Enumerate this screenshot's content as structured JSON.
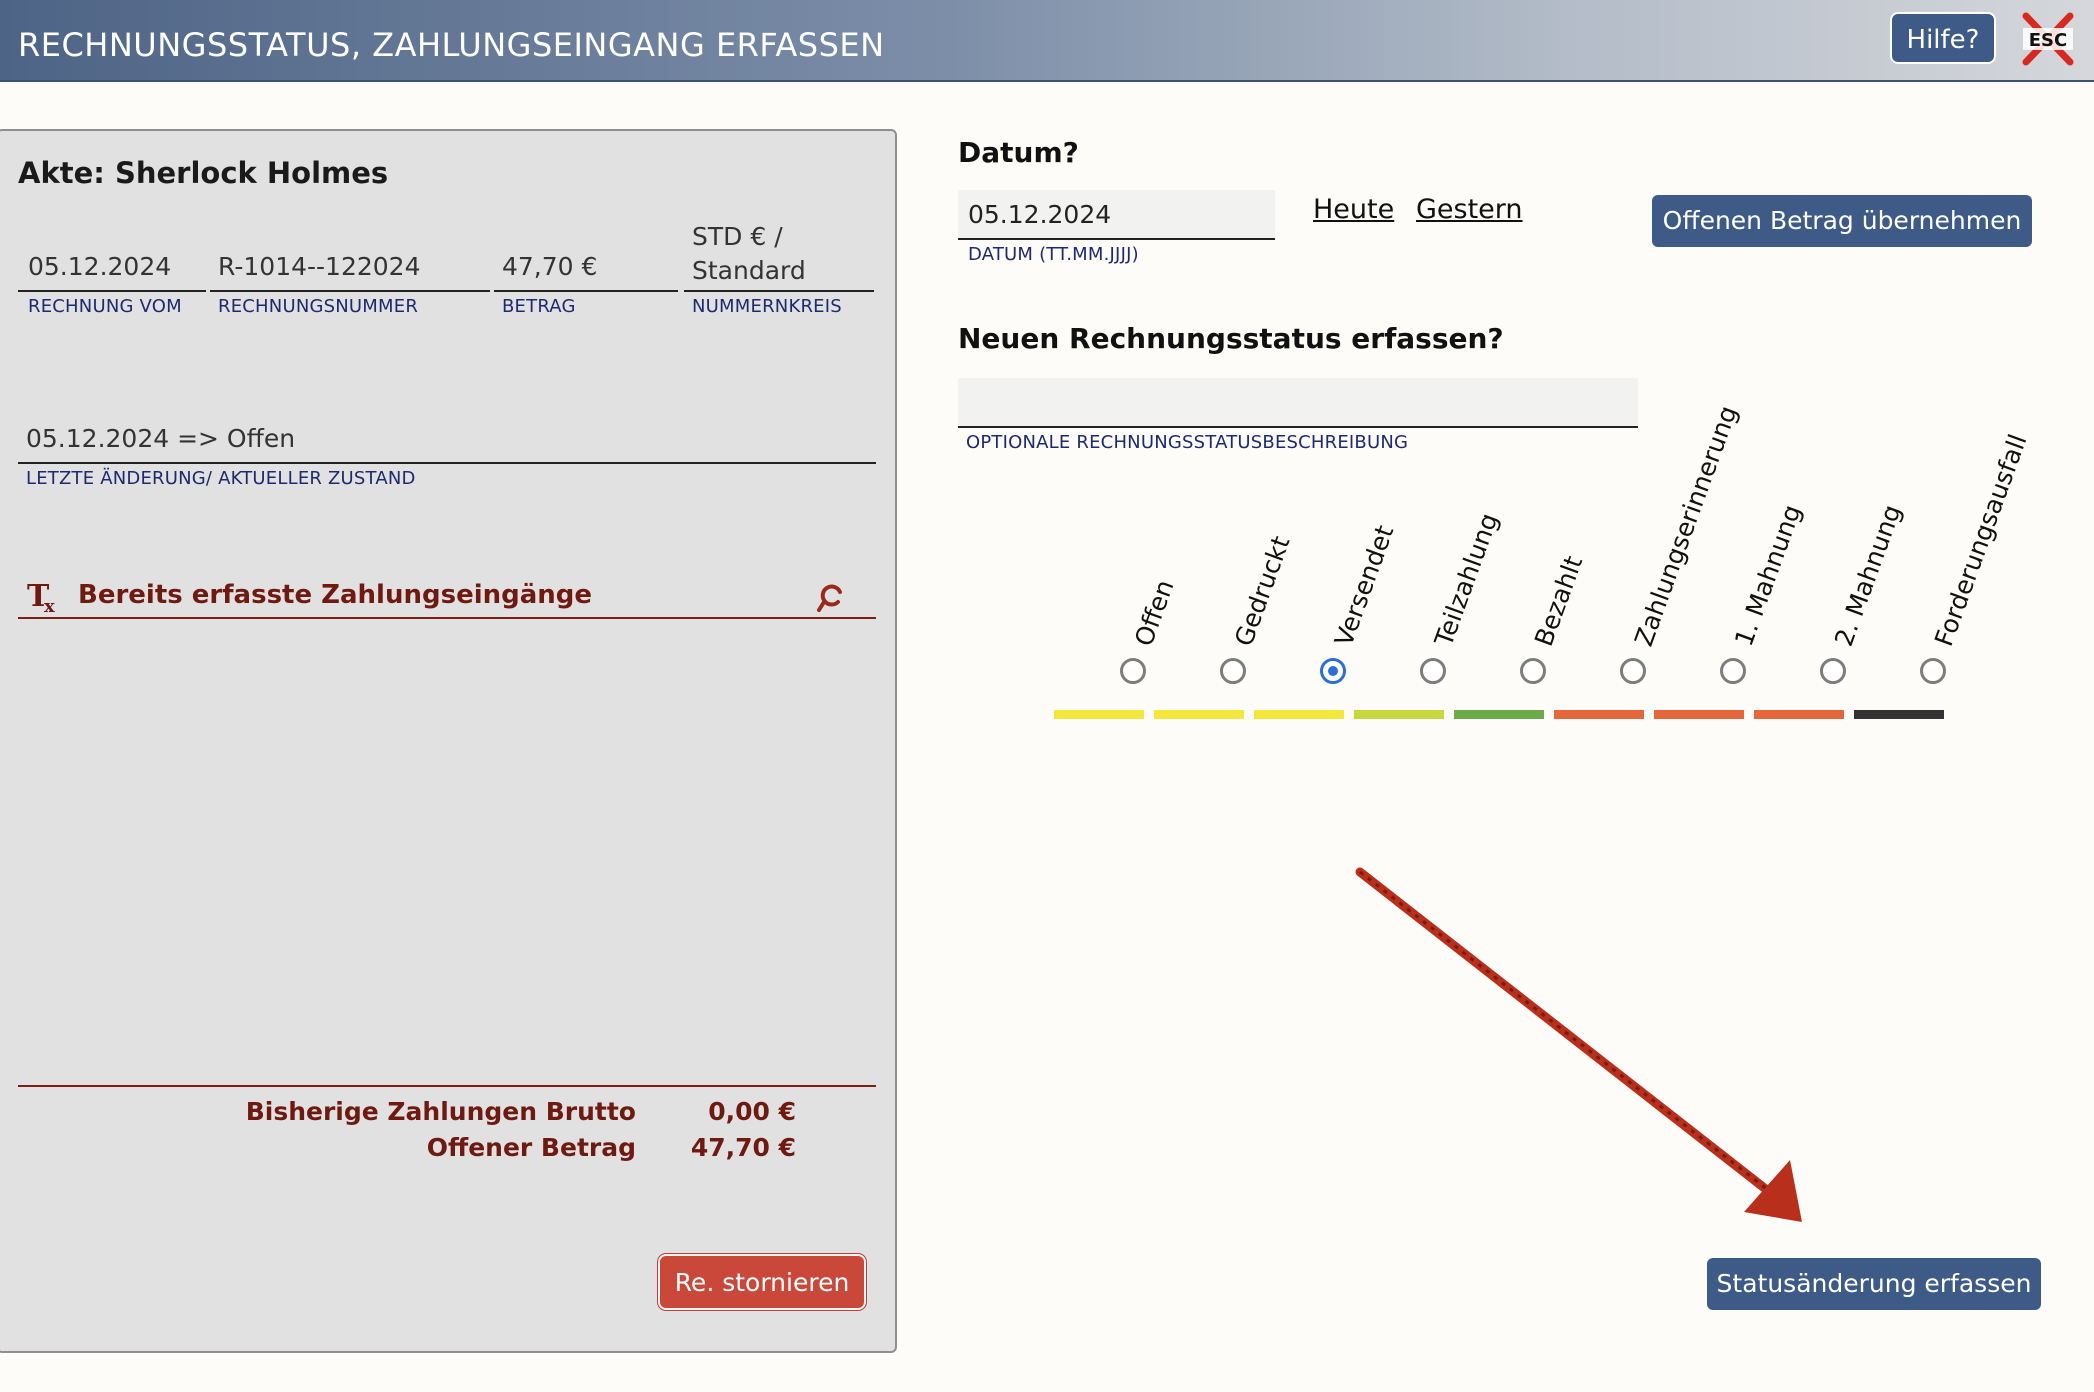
{
  "window": {
    "title": "RECHNUNGSSTATUS, ZAHLUNGSEINGANG ERFASSEN",
    "help_label": "Hilfe?",
    "esc_label": "ESC"
  },
  "left": {
    "akte": "Akte: Sherlock Holmes",
    "fields": {
      "rechnung_vom": {
        "value": "05.12.2024",
        "label": "RECHNUNG VOM"
      },
      "rechnungsnummer": {
        "value": "R-1014--122024",
        "label": "RECHNUNGSNUMMER"
      },
      "betrag": {
        "value": "47,70 €",
        "label": "BETRAG"
      },
      "nummernkreis": {
        "value_line1": "STD € /",
        "value_line2": "Standard",
        "label": "NUMMERNKREIS"
      }
    },
    "letzte_aenderung": {
      "value": "05.12.2024 => Offen",
      "label": "LETZTE ÄNDERUNG/ AKTUELLER ZUSTAND"
    },
    "payments_section_title": "Bereits erfasste Zahlungseingänge",
    "summary": {
      "paid_label": "Bisherige Zahlungen Brutto",
      "paid_value": "0,00 €",
      "open_label": "Offener Betrag",
      "open_value": "47,70 €"
    },
    "storno_label": "Re. stornieren"
  },
  "right": {
    "date_heading": "Datum?",
    "date_value": "05.12.2024",
    "date_label": "DATUM (TT.MM.JJJJ)",
    "today_link": "Heute",
    "yesterday_link": "Gestern",
    "take_open_amount_label": "Offenen Betrag übernehmen",
    "status_heading": "Neuen Rechnungsstatus erfassen?",
    "status_desc_value": "",
    "status_desc_label": "OPTIONALE RECHNUNGSSTATUSBESCHREIBUNG",
    "statuses": [
      {
        "label": "Offen",
        "color": "#f5e63b",
        "checked": false
      },
      {
        "label": "Gedruckt",
        "color": "#f5e63b",
        "checked": false
      },
      {
        "label": "Versendet",
        "color": "#f5e63b",
        "checked": true
      },
      {
        "label": "Teilzahlung",
        "color": "#c8d83c",
        "checked": false
      },
      {
        "label": "Bezahlt",
        "color": "#6aaa48",
        "checked": false
      },
      {
        "label": "Zahlungserinnerung",
        "color": "#e6663c",
        "checked": false
      },
      {
        "label": "1. Mahnung",
        "color": "#e6663c",
        "checked": false
      },
      {
        "label": "2. Mahnung",
        "color": "#e6663c",
        "checked": false
      },
      {
        "label": "Forderungsausfall",
        "color": "#333333",
        "checked": false
      }
    ],
    "submit_label": "Statusänderung erfassen"
  }
}
